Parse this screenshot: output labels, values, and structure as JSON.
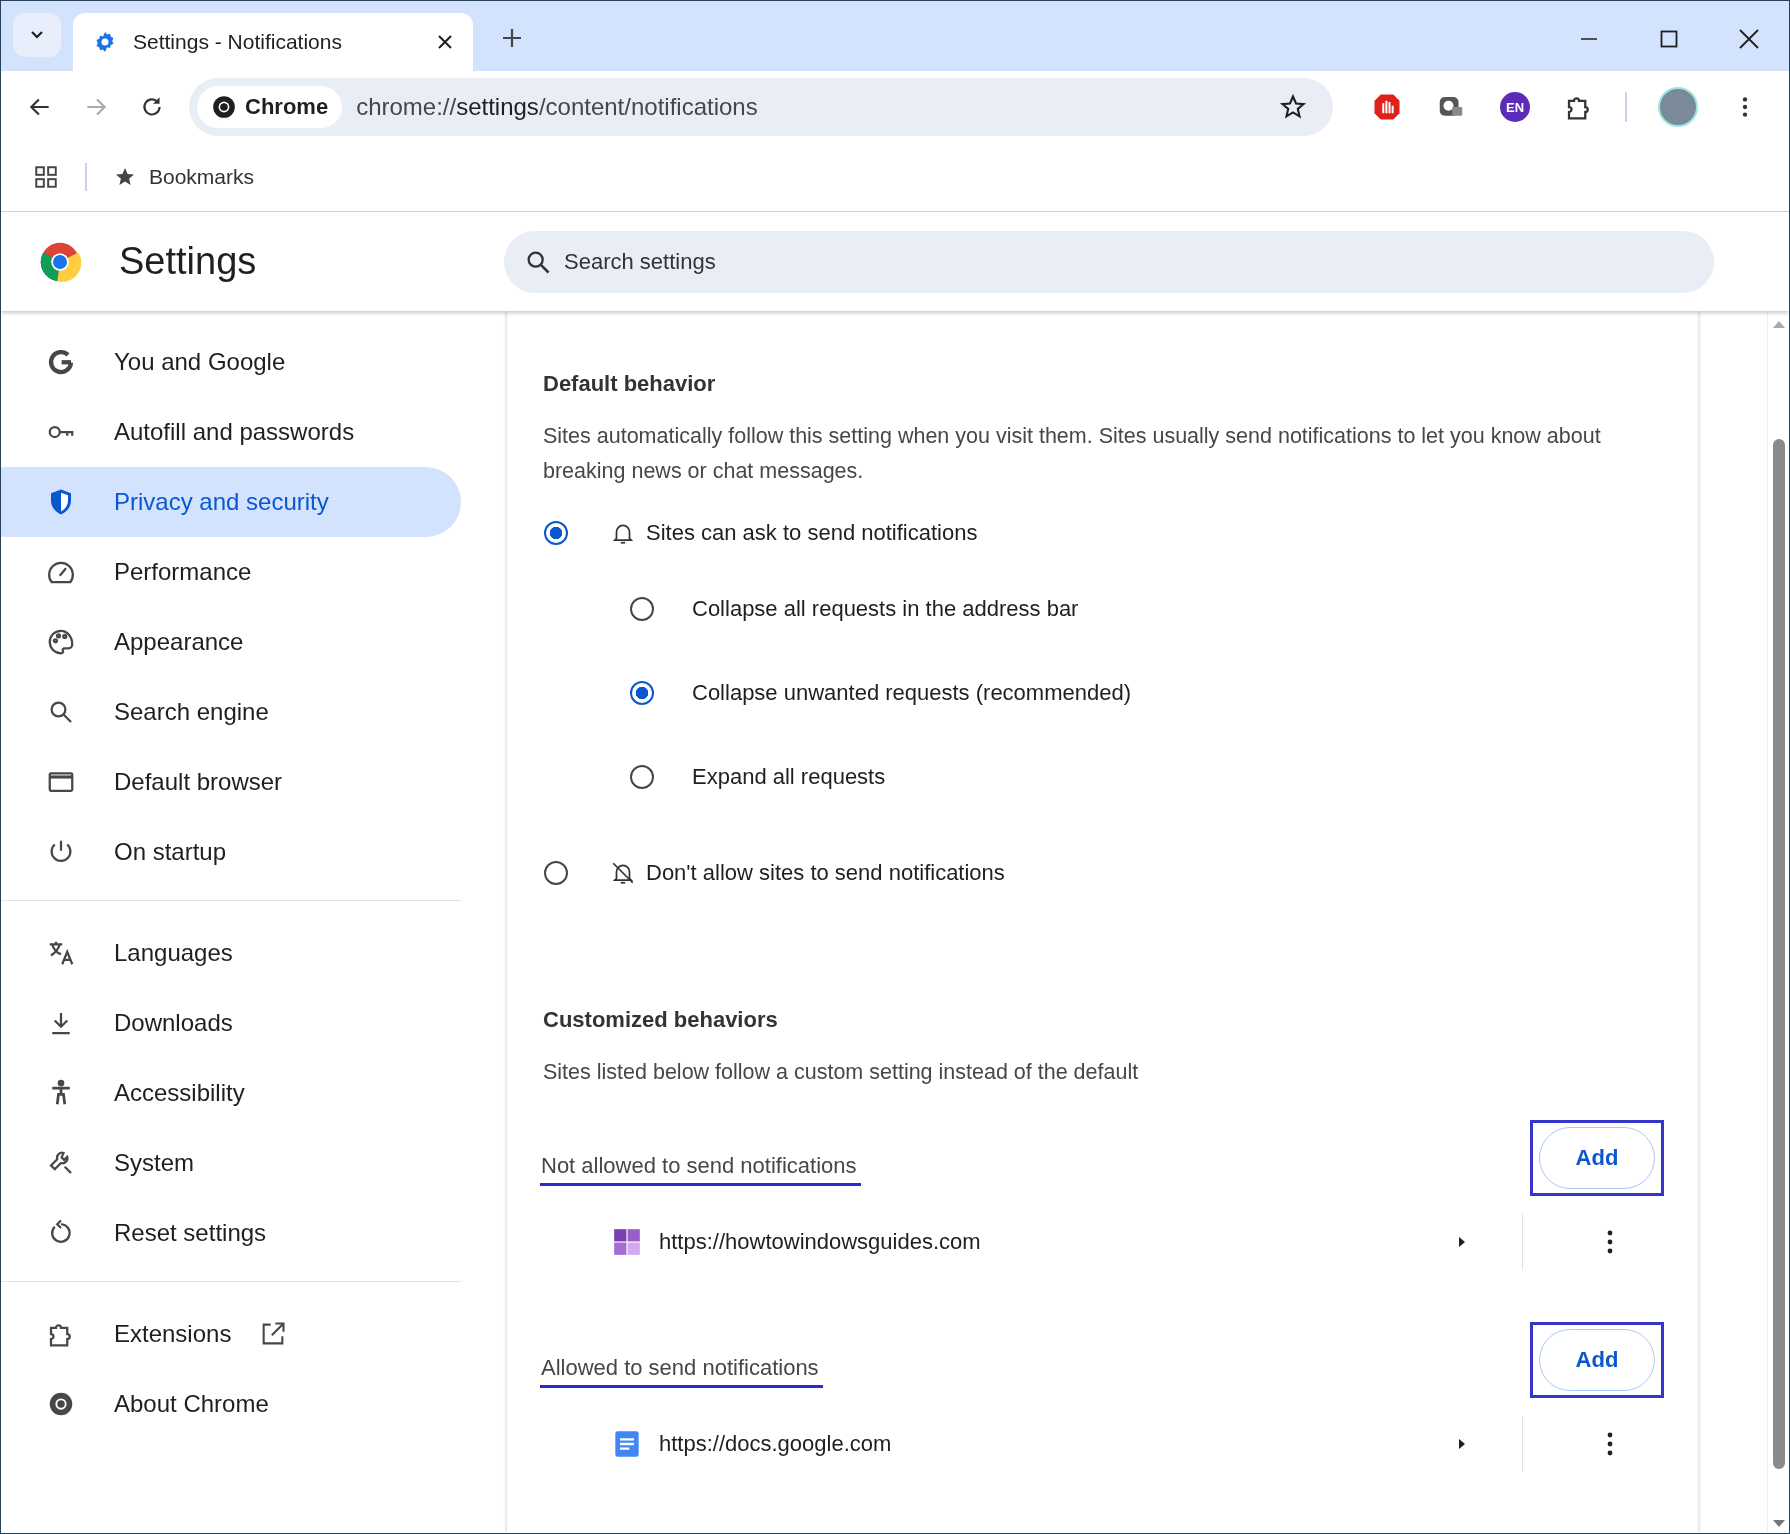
{
  "tab_strip": {
    "tabs": [
      {
        "title": "Settings - Notifications",
        "selected": true
      }
    ]
  },
  "toolbar": {
    "chip": "Chrome",
    "url": {
      "scheme": "chrome://",
      "host": "settings",
      "path": "/content/notifications"
    },
    "language_badge": "EN"
  },
  "bookmarks_bar": {
    "label": "Bookmarks"
  },
  "header": {
    "title": "Settings",
    "search_placeholder": "Search settings"
  },
  "sidebar": {
    "groups": [
      [
        {
          "label": "You and Google",
          "kind": "google",
          "selected": false
        },
        {
          "label": "Autofill and passwords",
          "kind": "key",
          "selected": false
        },
        {
          "label": "Privacy and security",
          "kind": "shield",
          "selected": true
        },
        {
          "label": "Performance",
          "kind": "gauge",
          "selected": false
        },
        {
          "label": "Appearance",
          "kind": "palette",
          "selected": false
        },
        {
          "label": "Search engine",
          "kind": "search",
          "selected": false
        },
        {
          "label": "Default browser",
          "kind": "browser",
          "selected": false
        },
        {
          "label": "On startup",
          "kind": "power",
          "selected": false
        }
      ],
      [
        {
          "label": "Languages",
          "kind": "translate",
          "selected": false
        },
        {
          "label": "Downloads",
          "kind": "download",
          "selected": false
        },
        {
          "label": "Accessibility",
          "kind": "accessibility",
          "selected": false
        },
        {
          "label": "System",
          "kind": "wrench",
          "selected": false
        },
        {
          "label": "Reset settings",
          "kind": "reset",
          "selected": false
        }
      ],
      [
        {
          "label": "Extensions",
          "kind": "puzzle",
          "selected": false,
          "external": true
        },
        {
          "label": "About Chrome",
          "kind": "chrome",
          "selected": false
        }
      ]
    ]
  },
  "default_behavior": {
    "heading": "Default behavior",
    "description": "Sites automatically follow this setting when you visit them. Sites usually send notifications to let you know about breaking news or chat messages.",
    "options": [
      {
        "label": "Sites can ask to send notifications",
        "kind": "bell",
        "selected": true,
        "children": [
          {
            "label": "Collapse all requests in the address bar",
            "selected": false
          },
          {
            "label": "Collapse unwanted requests (recommended)",
            "selected": true
          },
          {
            "label": "Expand all requests",
            "selected": false
          }
        ]
      },
      {
        "label": "Don't allow sites to send notifications",
        "kind": "bell-off",
        "selected": false
      }
    ]
  },
  "customized_behaviors": {
    "heading": "Customized behaviors",
    "description": "Sites listed below follow a custom setting instead of the default",
    "sections": [
      {
        "title": "Not allowed to send notifications",
        "button": "Add",
        "sites": [
          {
            "url": "https://howtowindowsguides.com",
            "kind": "tiles"
          }
        ]
      },
      {
        "title": "Allowed to send notifications",
        "button": "Add",
        "sites": [
          {
            "url": "https://docs.google.com",
            "kind": "doc"
          }
        ]
      }
    ]
  }
}
